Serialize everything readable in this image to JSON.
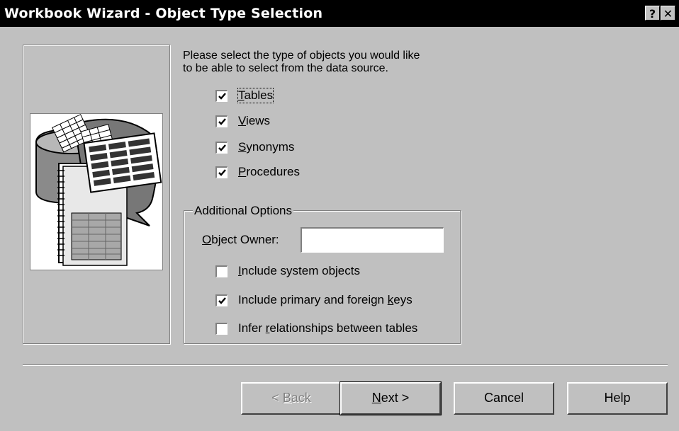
{
  "window": {
    "title": "Workbook Wizard - Object Type Selection",
    "help_button": "?",
    "close_button": "✕"
  },
  "instructions": {
    "line1": "Please select the type of objects you would like",
    "line2": "to be able to select from the data source."
  },
  "object_types": [
    {
      "pre": "",
      "key": "T",
      "post": "ables",
      "checked": true
    },
    {
      "pre": "",
      "key": "V",
      "post": "iews",
      "checked": true
    },
    {
      "pre": "",
      "key": "S",
      "post": "ynonyms",
      "checked": true
    },
    {
      "pre": "",
      "key": "P",
      "post": "rocedures",
      "checked": true
    }
  ],
  "additional_options": {
    "title": "Additional Options",
    "owner_label_key": "O",
    "owner_label_rest": "bject Owner:",
    "owner_value": "",
    "options": [
      {
        "pre": "",
        "key": "I",
        "post": "nclude system objects",
        "checked": false
      },
      {
        "pre": "Include primary and foreign ",
        "key": "k",
        "post": "eys",
        "checked": true
      },
      {
        "pre": "Infer ",
        "key": "r",
        "post": "elationships between tables",
        "checked": false
      }
    ]
  },
  "buttons": {
    "back": {
      "pre": "< ",
      "key": "B",
      "post": "ack",
      "enabled": false
    },
    "next": {
      "pre": "",
      "key": "N",
      "post": "ext >",
      "enabled": true
    },
    "cancel": "Cancel",
    "help": "Help"
  },
  "colors": {
    "face": "#c0c0c0",
    "titlebar": "#000000",
    "disabled_text": "#808080"
  }
}
